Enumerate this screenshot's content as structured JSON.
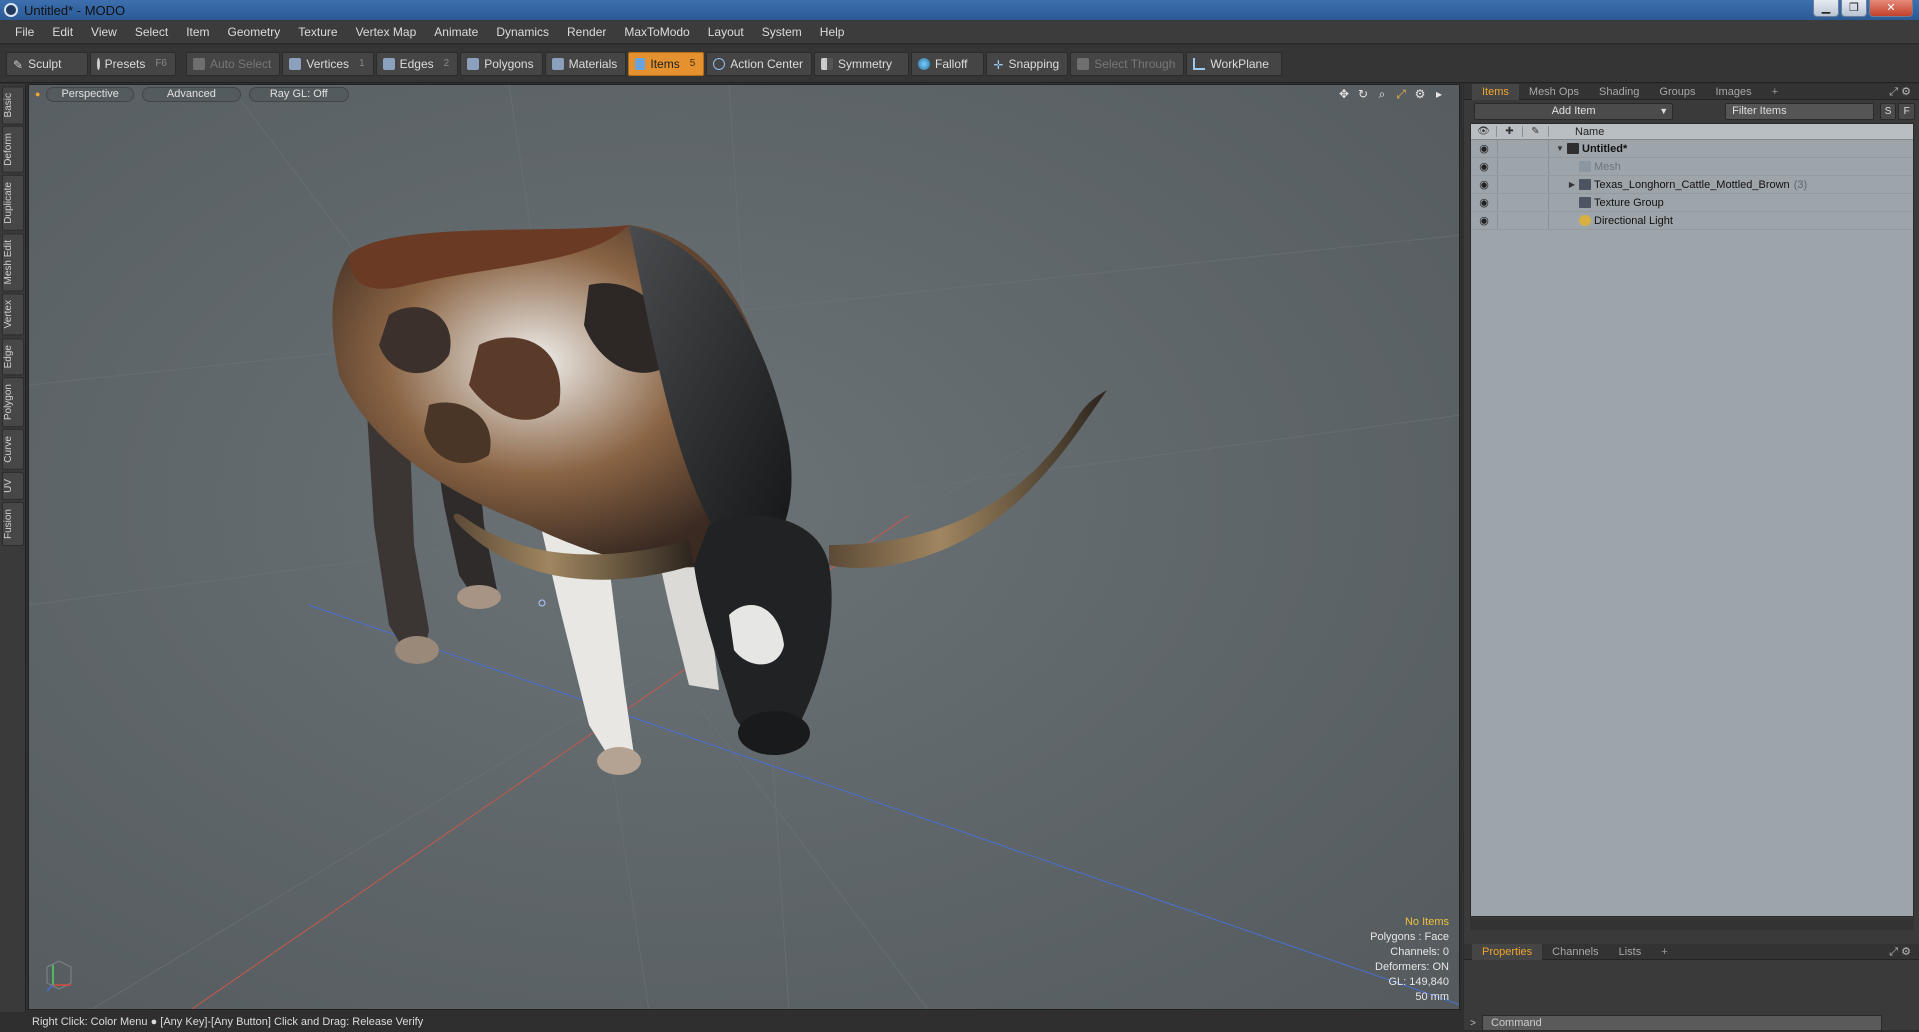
{
  "window": {
    "title": "Untitled* - MODO"
  },
  "menu": [
    "File",
    "Edit",
    "View",
    "Select",
    "Item",
    "Geometry",
    "Texture",
    "Vertex Map",
    "Animate",
    "Dynamics",
    "Render",
    "MaxToModo",
    "Layout",
    "System",
    "Help"
  ],
  "toolbar": {
    "sculpt": "Sculpt",
    "presets": "Presets",
    "presets_key": "F6",
    "auto_select": "Auto Select",
    "vertices": "Vertices",
    "vertices_key": "1",
    "edges": "Edges",
    "edges_key": "2",
    "polygons": "Polygons",
    "materials": "Materials",
    "items": "Items",
    "items_key": "5",
    "action_center": "Action Center",
    "symmetry": "Symmetry",
    "falloff": "Falloff",
    "snapping": "Snapping",
    "select_through": "Select Through",
    "workplane": "WorkPlane"
  },
  "left_tabs": [
    "Basic",
    "Deform",
    "Duplicate",
    "Mesh Edit",
    "Vertex",
    "Edge",
    "Polygon",
    "Curve",
    "UV",
    "Fusion"
  ],
  "viewport": {
    "view_mode": "Perspective",
    "shading": "Advanced",
    "render_mode": "Ray GL: Off",
    "stats": {
      "selection": "No Items",
      "polygons": "Polygons : Face",
      "channels": "Channels: 0",
      "deformers": "Deformers: ON",
      "gl": "GL: 149,840",
      "grid": "50 mm"
    }
  },
  "panel": {
    "tabs": [
      "Items",
      "Mesh Ops",
      "Shading",
      "Groups",
      "Images"
    ],
    "add_item": "Add Item",
    "filter_placeholder": "Filter Items",
    "btn_s": "S",
    "btn_f": "F",
    "column_name": "Name",
    "items": [
      {
        "label": "Untitled*",
        "bold": true,
        "dim": false,
        "count": "",
        "indent": 0,
        "tri": "▼"
      },
      {
        "label": "Mesh",
        "bold": false,
        "dim": true,
        "count": "",
        "indent": 1,
        "tri": ""
      },
      {
        "label": "Texas_Longhorn_Cattle_Mottled_Brown",
        "bold": false,
        "dim": false,
        "count": "(3)",
        "indent": 1,
        "tri": "▶"
      },
      {
        "label": "Texture Group",
        "bold": false,
        "dim": false,
        "count": "",
        "indent": 1,
        "tri": ""
      },
      {
        "label": "Directional Light",
        "bold": false,
        "dim": false,
        "count": "",
        "indent": 1,
        "tri": ""
      }
    ]
  },
  "lower_tabs": [
    "Properties",
    "Channels",
    "Lists"
  ],
  "command_placeholder": "Command",
  "status": "Right Click: Color Menu ● [Any Key]-[Any Button] Click and Drag: Release Verify",
  "colors": {
    "accent": "#e3922f",
    "viewport_bg": "#5e6569",
    "list_bg": "#9ea5aa"
  }
}
